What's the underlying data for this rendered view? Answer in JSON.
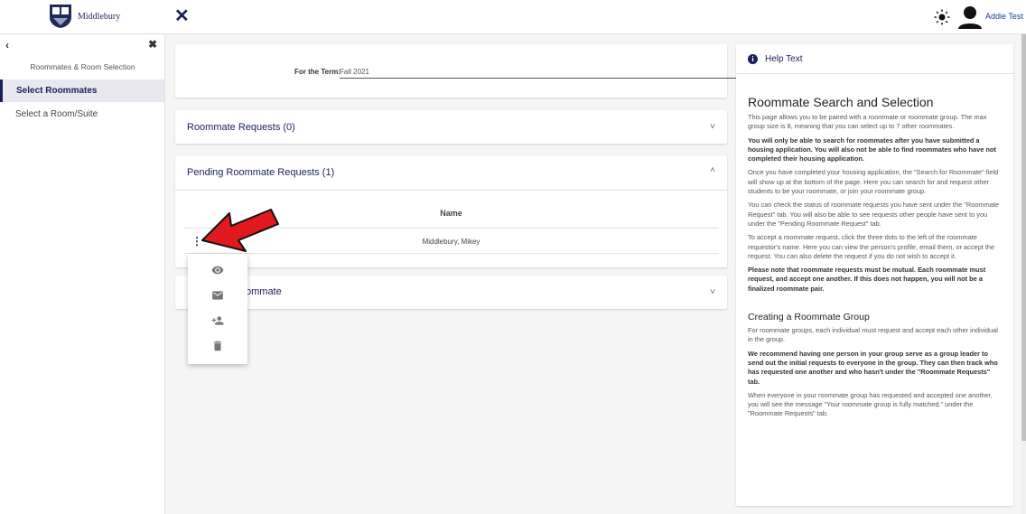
{
  "header": {
    "brand": "Middlebury",
    "close_symbol": "✕",
    "theme_icon": "sun-icon",
    "user_name": "Addie Test"
  },
  "sidebar": {
    "back_symbol": "‹",
    "close_symbol": "✖",
    "title": "Roommates & Room Selection",
    "items": [
      {
        "label": "Select Roommates",
        "active": true
      },
      {
        "label": "Select a Room/Suite",
        "active": false
      }
    ]
  },
  "term": {
    "label": "For the Term:",
    "value": "Fall 2021"
  },
  "panels": {
    "roommate_requests": {
      "title": "Roommate Requests (0)",
      "chevron": "˅"
    },
    "pending": {
      "title": "Pending Roommate Requests (1)",
      "chevron": "˄",
      "column_header": "Name",
      "rows": [
        {
          "name": "Middlebury, Mikey"
        }
      ],
      "menu_symbol": "⋮"
    },
    "search": {
      "title_partial": "ommate",
      "chevron": "˅"
    }
  },
  "row_menu": {
    "items": [
      {
        "icon": "eye-icon"
      },
      {
        "icon": "email-icon"
      },
      {
        "icon": "person-add-icon"
      },
      {
        "icon": "trash-icon"
      }
    ]
  },
  "help": {
    "header": "Help Text",
    "heading": "Roommate Search and Selection",
    "p1": "This page allows you to be paired with a roommate or roommate group. The max group size is 8, meaning that you can select up to 7 other roommates.",
    "p2": "You will only be able to search for roommates after you have submitted a housing application. You will also not be able to find roommates who have not completed their housing application.",
    "p3": "Once you have completed your housing application, the \"Search for Roommate\" field will show up at the bottom of the page. Here you can search for and request other students to be your roommate, or join your roommate group.",
    "p4": "You can check the status of roommate requests you have sent under the \"Roommate Request\" tab. You will also be able to see requests other people have sent to you under the \"Pending Roommate Request\" tab.",
    "p5": "To accept a roommate request, click the three dots to the left of the roommate requestor's name. Here you can view the person's profile, email them, or accept the request. You can also delete the request if you do not wish to accept it.",
    "p6": "Please note that roommate requests must be mutual. Each roommate must request, and accept one another. If this does not happen, you will not be a finalized roommate pair.",
    "heading2": "Creating a Roommate Group",
    "p7": "For roommate groups, each individual must request and accept each other individual in the group.",
    "p8": "We recommend having one person in your group serve as a group leader to send out the initial requests to everyone in the group. They can then track who has requested one another and who hasn't under the \"Roommate Requests\" tab.",
    "p9": "When everyone in your roommate group has requested and accepted one another, you will see the message \"Your roommate group is fully matched.\" under the \"Roommate Requests\" tab."
  },
  "colors": {
    "primary": "#1a1f5c",
    "arrow": "#e0191c",
    "accent_link": "#1a3e8c"
  }
}
